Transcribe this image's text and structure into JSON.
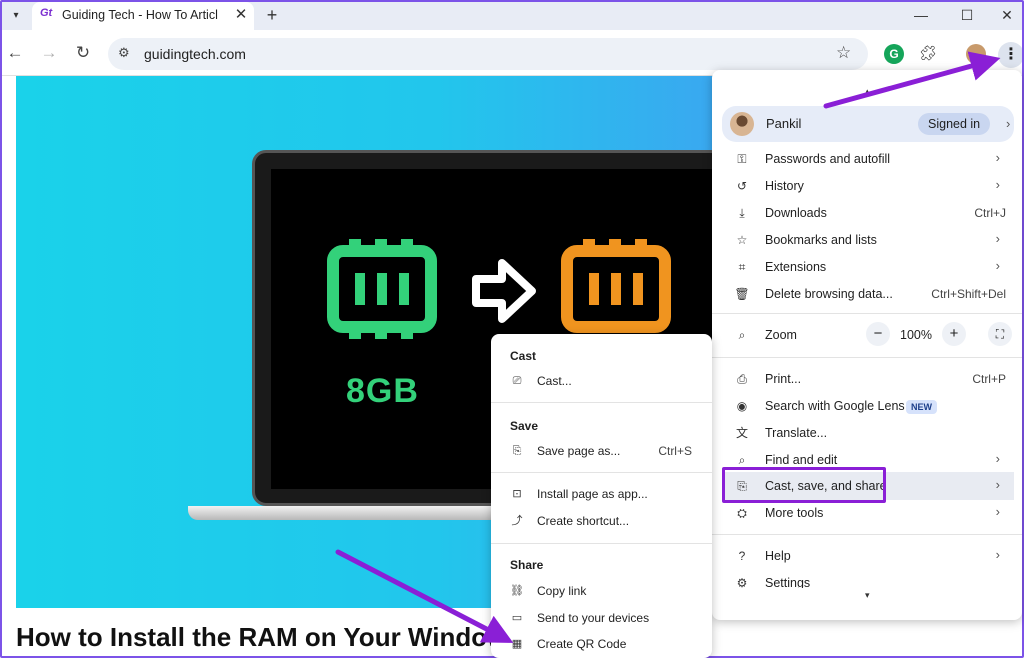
{
  "tab": {
    "favicon": "Gt",
    "title": "Guiding Tech - How To Articles,",
    "close": "✕",
    "new": "+"
  },
  "window": {
    "minimize": "—",
    "maximize": "☐",
    "close": "✕"
  },
  "toolbar": {
    "back": "←",
    "forward": "→",
    "reload": "↻",
    "url": "guidingtech.com",
    "site_info_icon": "tune-icon",
    "bookmark_icon": "star-icon",
    "grammarly": "G",
    "extensions_icon": "puzzle-icon",
    "menu": "⋮"
  },
  "page": {
    "ram_label": "8GB",
    "heading": "How to Install the RAM on Your Windows"
  },
  "menu": {
    "profile": {
      "name": "Pankil",
      "badge": "Signed in"
    },
    "items": [
      {
        "label": "Passwords and autofill",
        "icon": "key-icon",
        "chevron": true
      },
      {
        "label": "History",
        "icon": "history-icon",
        "chevron": true
      },
      {
        "label": "Downloads",
        "icon": "download-icon",
        "shortcut": "Ctrl+J"
      },
      {
        "label": "Bookmarks and lists",
        "icon": "star-icon",
        "chevron": true
      },
      {
        "label": "Extensions",
        "icon": "puzzle-icon",
        "chevron": true
      },
      {
        "label": "Delete browsing data...",
        "icon": "trash-icon",
        "shortcut": "Ctrl+Shift+Del"
      }
    ],
    "zoom": {
      "label": "Zoom",
      "minus": "−",
      "value": "100%",
      "plus": "+",
      "fullscreen": "⛶"
    },
    "items2": [
      {
        "label": "Print...",
        "icon": "print-icon",
        "shortcut": "Ctrl+P"
      },
      {
        "label": "Search with Google Lens",
        "icon": "lens-icon",
        "badge": "NEW"
      },
      {
        "label": "Translate...",
        "icon": "translate-icon"
      },
      {
        "label": "Find and edit",
        "icon": "find-icon",
        "chevron": true
      },
      {
        "label": "Cast, save, and share",
        "icon": "cast-save-icon",
        "chevron": true
      },
      {
        "label": "More tools",
        "icon": "toolbox-icon",
        "chevron": true
      }
    ],
    "items3": [
      {
        "label": "Help",
        "icon": "help-icon",
        "chevron": true
      },
      {
        "label": "Settings",
        "icon": "gear-icon"
      }
    ]
  },
  "submenu": {
    "cast_header": "Cast",
    "cast": "Cast...",
    "save_header": "Save",
    "save_page": "Save page as...",
    "save_page_shortcut": "Ctrl+S",
    "install_app": "Install page as app...",
    "create_shortcut": "Create shortcut...",
    "share_header": "Share",
    "copy_link": "Copy link",
    "send_devices": "Send to your devices",
    "create_qr": "Create QR Code"
  },
  "colors": {
    "accent_purple": "#8a1fd6",
    "hero_cyan": "#1ad2ea",
    "ram_green": "#33d17a",
    "ram_orange": "#f0941f"
  }
}
